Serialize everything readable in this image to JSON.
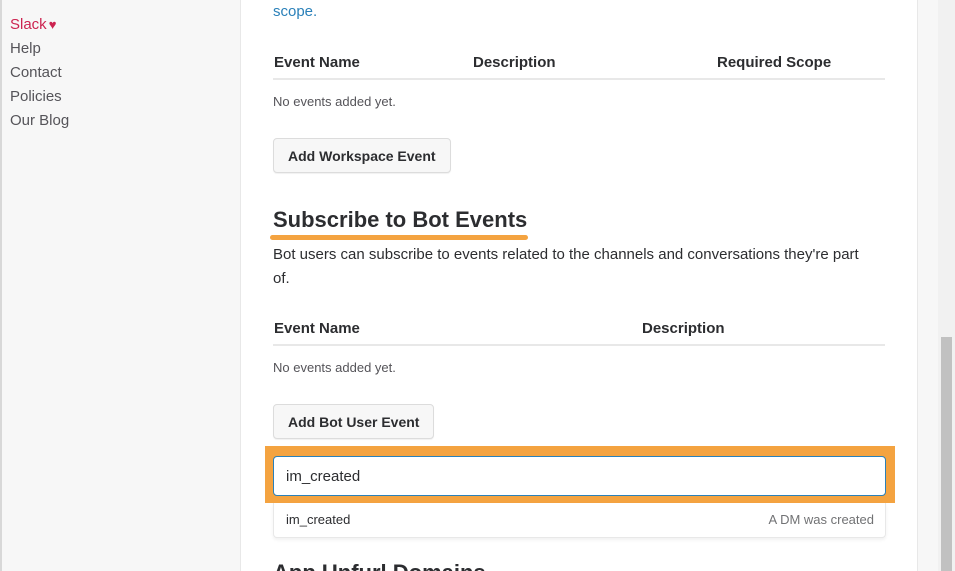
{
  "sidebar": {
    "links": [
      {
        "label": "Slack",
        "heart": "♥"
      },
      {
        "label": "Help"
      },
      {
        "label": "Contact"
      },
      {
        "label": "Policies"
      },
      {
        "label": "Our Blog"
      }
    ]
  },
  "workspace_events": {
    "scope_link": "scope.",
    "headers": [
      "Event Name",
      "Description",
      "Required Scope"
    ],
    "empty_text": "No events added yet.",
    "add_button": "Add Workspace Event"
  },
  "bot_events": {
    "title": "Subscribe to Bot Events",
    "description": "Bot users can subscribe to events related to the channels and conversations they're part of.",
    "headers": [
      "Event Name",
      "Description"
    ],
    "empty_text": "No events added yet.",
    "add_button": "Add Bot User Event",
    "input_value": "im_created",
    "suggestion": {
      "name": "im_created",
      "description": "A DM was created"
    }
  },
  "next_section": {
    "title": "App Unfurl Domains"
  },
  "colors": {
    "accent": "#f4a340",
    "link": "#2a80b9",
    "slack_red": "#cc2350"
  }
}
